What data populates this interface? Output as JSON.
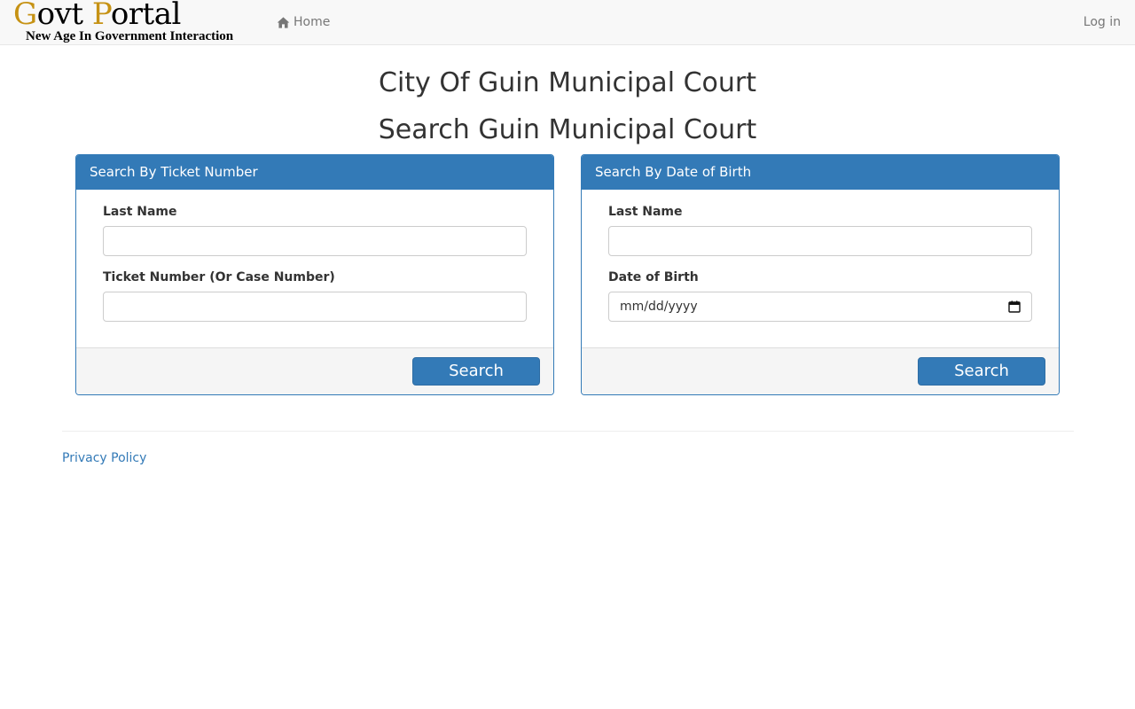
{
  "navbar": {
    "brand": {
      "title_first_initial": "G",
      "title_first_rest": "ovt",
      "title_second_initial": "P",
      "title_second_rest": "ortal",
      "tagline": "New Age In Government Interaction",
      "accent_color": "#c69214"
    },
    "home_label": "Home",
    "home_icon": "home-icon",
    "login_label": "Log in"
  },
  "main": {
    "title": "City Of Guin Municipal Court",
    "subtitle": "Search Guin Municipal Court"
  },
  "panels": {
    "ticket": {
      "heading": "Search By Ticket Number",
      "last_name_label": "Last Name",
      "last_name_value": "",
      "ticket_label": "Ticket Number (Or Case Number)",
      "ticket_value": "",
      "search_label": "Search"
    },
    "dob": {
      "heading": "Search By Date of Birth",
      "last_name_label": "Last Name",
      "last_name_value": "",
      "dob_label": "Date of Birth",
      "dob_placeholder": "mm/dd/yyyy",
      "calendar_icon": "calendar-icon",
      "search_label": "Search"
    }
  },
  "footer": {
    "privacy_label": "Privacy Policy"
  },
  "colors": {
    "primary": "#337ab7",
    "navbar_bg": "#f8f8f8",
    "link_muted": "#777777"
  }
}
